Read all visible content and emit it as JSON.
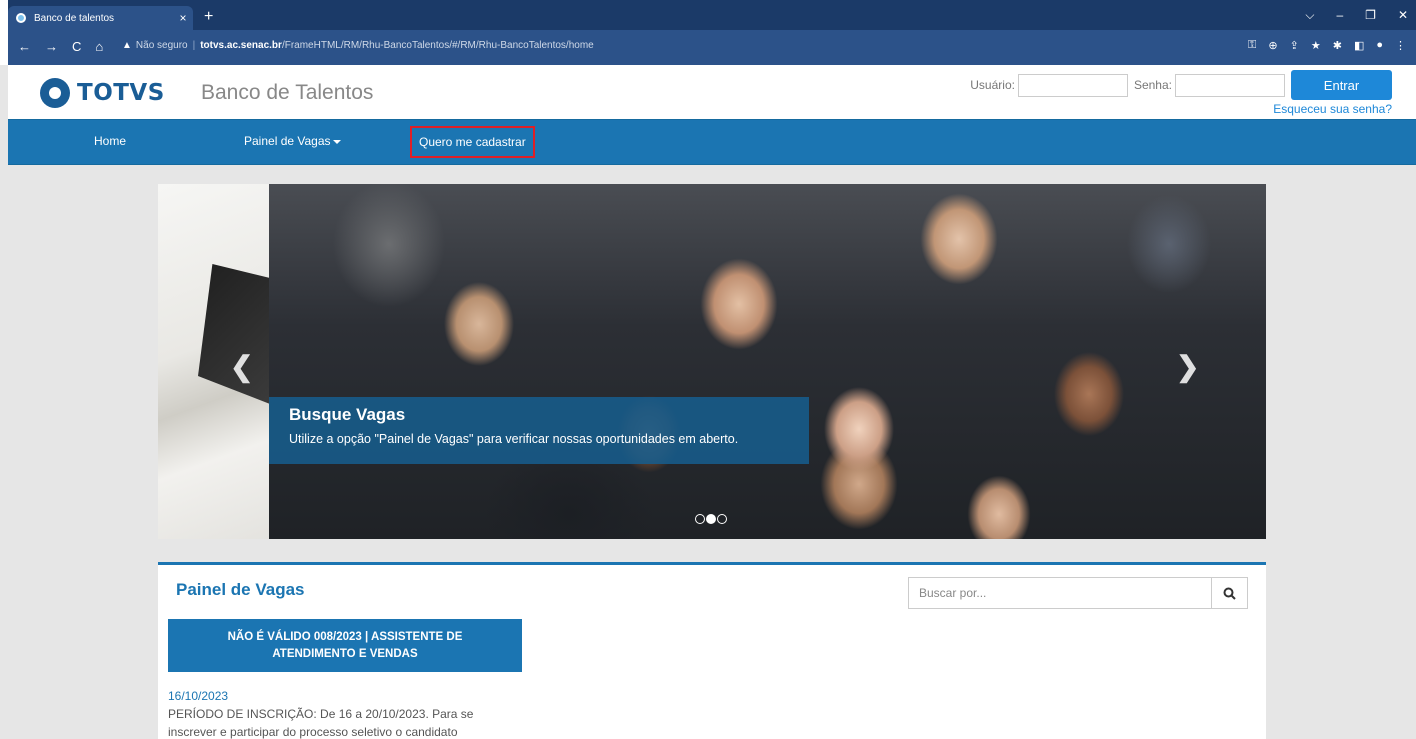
{
  "browser": {
    "tab_title": "Banco de talentos",
    "tab_close": "×",
    "new_tab": "+",
    "window_controls": [
      "⌵",
      "–",
      "❐",
      "✕"
    ],
    "nav": [
      "←",
      "→",
      "C",
      "⌂"
    ],
    "security_label": "Não seguro",
    "url_host": "totvs.ac.senac.br",
    "url_path": "/FrameHTML/RM/Rhu-BancoTalentos/#/RM/Rhu-BancoTalentos/home",
    "toolbar_icons": [
      "key-icon",
      "zoom-icon",
      "share-icon",
      "star-icon",
      "extensions-icon",
      "sidepanel-icon",
      "profile-icon",
      "menu-icon"
    ]
  },
  "header": {
    "logo_text": "TOTVS",
    "site_title": "Banco de Talentos",
    "user_label": "Usuário:",
    "password_label": "Senha:",
    "login_button": "Entrar",
    "forgot_link": "Esqueceu sua senha?"
  },
  "nav": {
    "home": "Home",
    "vagas": "Painel de Vagas",
    "cadastrar": "Quero me cadastrar"
  },
  "carousel": {
    "caption_title": "Busque Vagas",
    "caption_text": "Utilize a opção \"Painel de Vagas\" para verificar nossas oportunidades em aberto.",
    "active_index": 1,
    "slide_count": 3
  },
  "vagas": {
    "title": "Painel de Vagas",
    "search_placeholder": "Buscar por...",
    "card": {
      "title": "NÃO É VÁLIDO 008/2023 | ASSISTENTE DE ATENDIMENTO E VENDAS",
      "date": "16/10/2023",
      "line1": "PERÍODO DE INSCRIÇÃO: De 16 a 20/10/2023. Para se",
      "line2": "inscrever e participar do processo seletivo o candidato"
    }
  },
  "colors": {
    "brand_blue": "#1b75b2",
    "button_blue": "#1e88d8",
    "highlight_red": "#e01f26"
  }
}
